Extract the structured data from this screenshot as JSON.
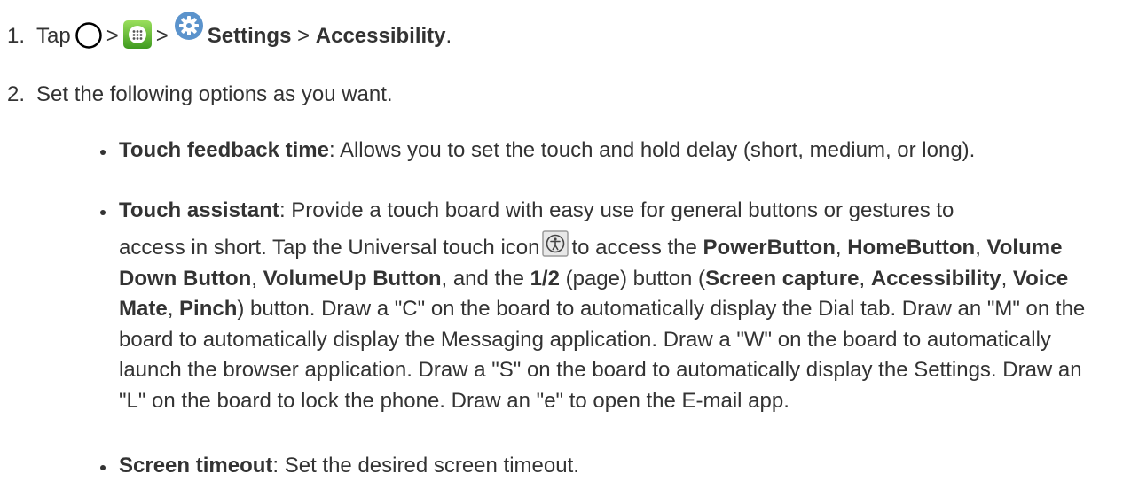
{
  "steps": [
    {
      "number": "1.",
      "tap": "Tap",
      "sep1": ">",
      "sep2": ">",
      "settings": "Settings",
      "sep3": " > ",
      "accessibility": "Accessibility",
      "end": "."
    },
    {
      "number": "2.",
      "text": "Set the following options as you want."
    }
  ],
  "options": [
    {
      "title": "Touch feedback time",
      "text": ": Allows you to set the touch and hold delay (short, medium, or long)."
    },
    {
      "title": "Touch assistant",
      "text_a": ": Provide a touch board with easy use for general buttons or gestures to",
      "text_b": "access in short. Tap the Universal touch icon",
      "text_c": "to access the ",
      "power": "PowerButton",
      "comma1": ", ",
      "home": "HomeButton",
      "comma2": ", ",
      "voldown": "Volume Down Button",
      "comma3": ", ",
      "volup": "VolumeUp Button",
      "and": ", and the ",
      "page": "1/2",
      "pagebtn": " (page) button (",
      "capture": "Screen capture",
      "comma4": ", ",
      "access": "Accessibility",
      "comma5": ", ",
      "voice": "Voice Mate",
      "comma6": ", ",
      "pinch": "Pinch",
      "rest": ") button. Draw a \"C\" on the board to automatically display the Dial tab. Draw an \"M\" on the board to automatically display the Messaging application. Draw a \"W\" on the board to automatically launch the browser application. Draw a \"S\" on the board to automatically display the Settings. Draw an \"L\" on the board to lock the phone. Draw an \"e\" to open the E-mail app."
    },
    {
      "title": "Screen timeout",
      "text": ": Set the desired screen timeout."
    }
  ],
  "icons": {
    "home": "home-circle-icon",
    "apps": "apps-grid-icon",
    "settings": "gear-icon",
    "universal_touch": "universal-touch-icon"
  }
}
